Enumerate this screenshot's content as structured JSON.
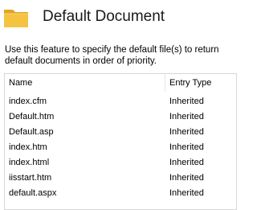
{
  "header": {
    "title": "Default Document",
    "icon": "folder-icon"
  },
  "description": {
    "line1": "Use this feature to specify the default file(s) to return",
    "line2": "default documents in order of priority."
  },
  "table": {
    "columns": {
      "name": "Name",
      "entry_type": "Entry Type"
    },
    "rows": [
      {
        "name": "index.cfm",
        "entry_type": "Inherited"
      },
      {
        "name": "Default.htm",
        "entry_type": "Inherited"
      },
      {
        "name": "Default.asp",
        "entry_type": "Inherited"
      },
      {
        "name": "index.htm",
        "entry_type": "Inherited"
      },
      {
        "name": "index.html",
        "entry_type": "Inherited"
      },
      {
        "name": "iisstart.htm",
        "entry_type": "Inherited"
      },
      {
        "name": "default.aspx",
        "entry_type": "Inherited"
      }
    ]
  },
  "colors": {
    "folder_body": "#f5c342",
    "folder_tab": "#e0a526",
    "border": "#d7d7d7"
  }
}
